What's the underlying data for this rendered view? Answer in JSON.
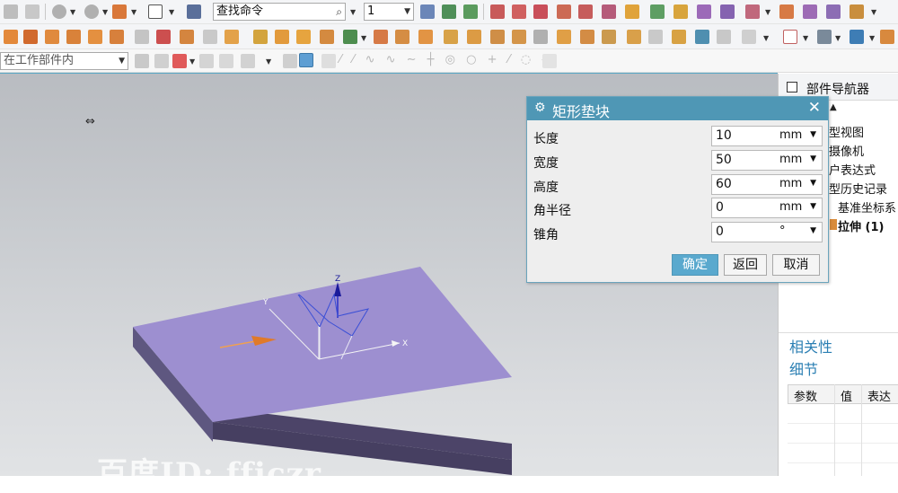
{
  "toolbar": {
    "command_finder_value": "查找命令",
    "layer_value": "1",
    "selection_scope_value": "在工作部件内"
  },
  "part_navigator": {
    "title": "部件导航器",
    "items": [
      {
        "label": "型视图",
        "bold": false
      },
      {
        "label": "摄像机",
        "bold": false
      },
      {
        "label": "户表达式",
        "bold": false
      },
      {
        "label": "型历史记录",
        "bold": false
      },
      {
        "label": "基准坐标系",
        "bold": false
      },
      {
        "label": "拉伸 (1)",
        "bold": true
      }
    ],
    "section_dependencies": "相关性",
    "section_details": "细节",
    "details_columns": [
      "参数",
      "值",
      "表达"
    ]
  },
  "dialog": {
    "title": "矩形垫块",
    "fields": [
      {
        "label": "长度",
        "value": "10",
        "unit": "mm"
      },
      {
        "label": "宽度",
        "value": "50",
        "unit": "mm"
      },
      {
        "label": "高度",
        "value": "60",
        "unit": "mm"
      },
      {
        "label": "角半径",
        "value": "0",
        "unit": "mm"
      },
      {
        "label": "锥角",
        "value": "0",
        "unit": "°"
      }
    ],
    "ok_label": "确定",
    "back_label": "返回",
    "cancel_label": "取消"
  },
  "viewport": {
    "axis_x": "X",
    "axis_y": "Y",
    "axis_z": "Z",
    "watermark": "百度ID: fficzr"
  },
  "colors": {
    "accent": "#4f97b5",
    "solid_top": "#9d8fd0",
    "solid_side": "#4c4468"
  }
}
